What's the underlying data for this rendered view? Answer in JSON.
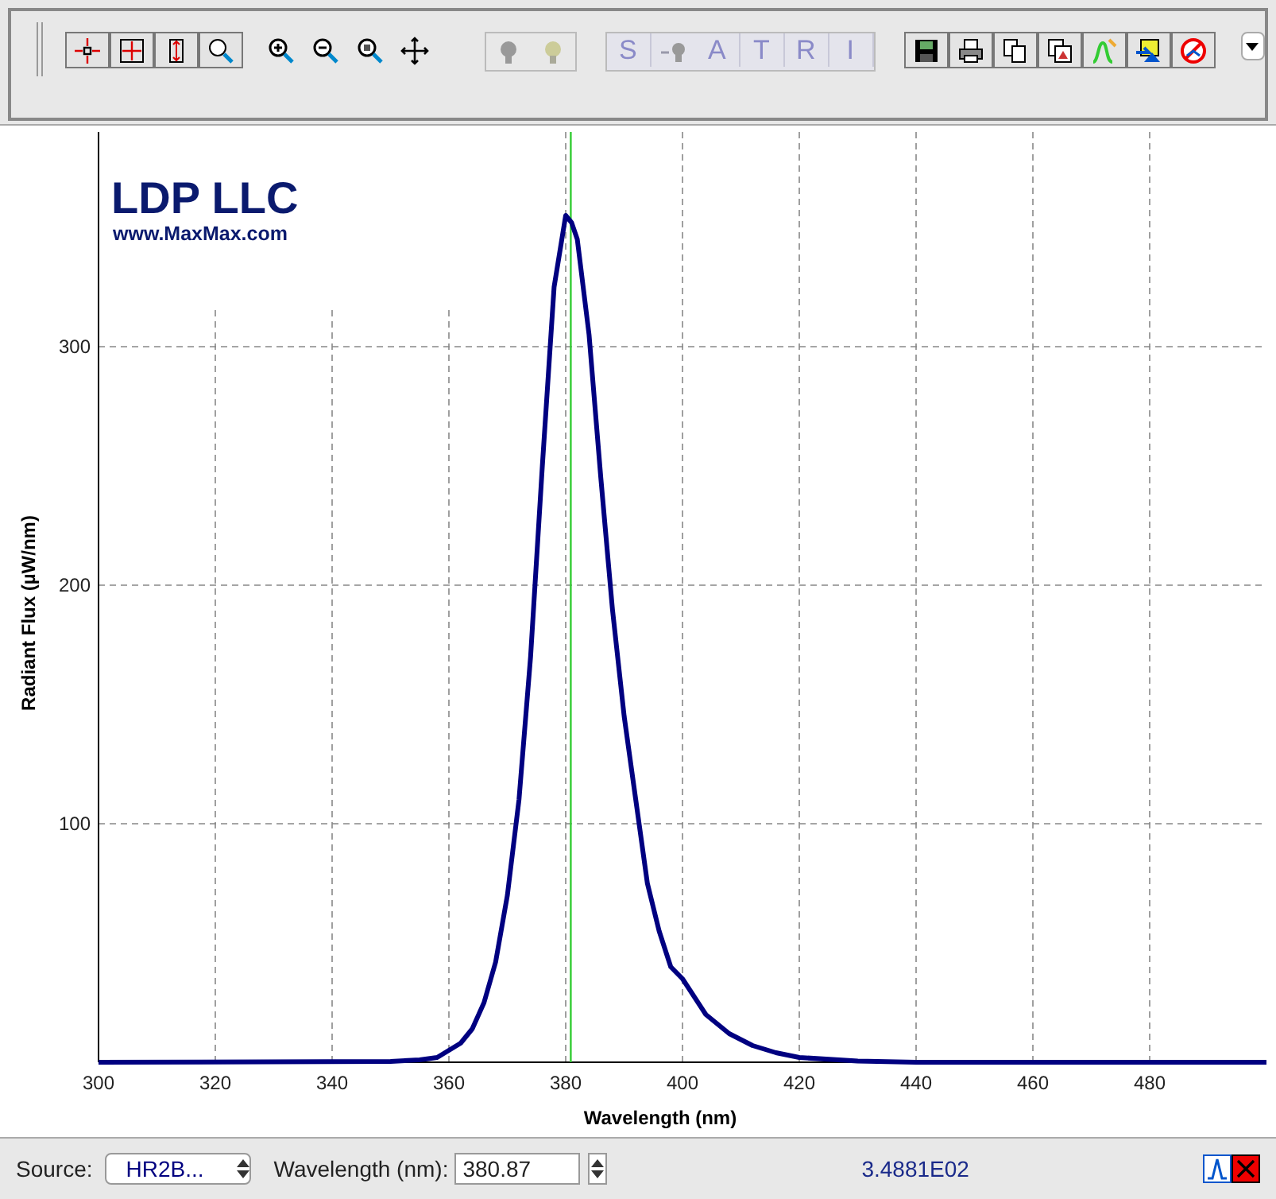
{
  "toolbar": {
    "letter_buttons": [
      {
        "label": "S",
        "disabled": true
      },
      {
        "label": "A",
        "disabled": true
      },
      {
        "label": "T",
        "disabled": true
      },
      {
        "label": "R",
        "disabled": true
      },
      {
        "label": "I",
        "disabled": true
      }
    ]
  },
  "plot": {
    "logo": {
      "title": "LDP LLC",
      "url": "www.MaxMax.com"
    },
    "chart_data": {
      "type": "line",
      "xlabel": "Wavelength (nm)",
      "ylabel": "Radiant Flux (µW/nm)",
      "xlim": [
        300,
        500
      ],
      "ylim": [
        0,
        390
      ],
      "xticks": [
        300,
        320,
        340,
        360,
        380,
        400,
        420,
        440,
        460,
        480
      ],
      "yticks": [
        100,
        200,
        300
      ],
      "x": [
        300,
        350,
        355,
        358,
        360,
        362,
        364,
        366,
        368,
        370,
        372,
        374,
        376,
        378,
        380,
        381,
        382,
        384,
        386,
        388,
        390,
        392,
        394,
        396,
        398,
        400,
        404,
        408,
        412,
        416,
        420,
        430,
        440,
        500
      ],
      "series": [
        {
          "color": "#000080",
          "values": [
            0,
            0.3,
            1,
            2,
            5,
            8,
            14,
            25,
            42,
            70,
            110,
            170,
            250,
            325,
            355,
            352,
            345,
            305,
            245,
            190,
            145,
            110,
            75,
            55,
            40,
            35,
            20,
            12,
            7,
            4,
            2,
            0.5,
            0,
            0
          ]
        }
      ],
      "grid": true,
      "ref_lines": [
        {
          "axis": "x",
          "value": 380.87,
          "color": "#33cc33"
        }
      ]
    }
  },
  "status_bar": {
    "source_label": "Source:",
    "source_value": "HR2B...",
    "wavelength_label": "Wavelength (nm):",
    "wavelength_value": "380.87",
    "reading": "3.4881E02"
  }
}
